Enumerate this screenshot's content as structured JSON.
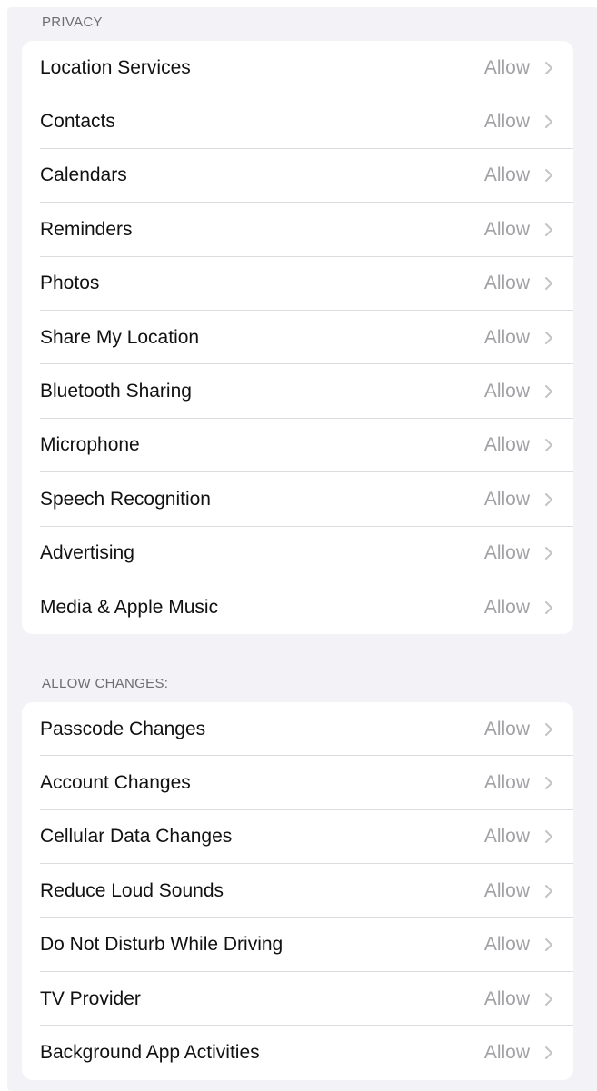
{
  "privacy": {
    "header": "PRIVACY",
    "items": [
      {
        "label": "Location Services",
        "value": "Allow"
      },
      {
        "label": "Contacts",
        "value": "Allow"
      },
      {
        "label": "Calendars",
        "value": "Allow"
      },
      {
        "label": "Reminders",
        "value": "Allow"
      },
      {
        "label": "Photos",
        "value": "Allow"
      },
      {
        "label": "Share My Location",
        "value": "Allow"
      },
      {
        "label": "Bluetooth Sharing",
        "value": "Allow"
      },
      {
        "label": "Microphone",
        "value": "Allow"
      },
      {
        "label": "Speech Recognition",
        "value": "Allow"
      },
      {
        "label": "Advertising",
        "value": "Allow"
      },
      {
        "label": "Media & Apple Music",
        "value": "Allow"
      }
    ]
  },
  "allow_changes": {
    "header": "ALLOW CHANGES:",
    "items": [
      {
        "label": "Passcode Changes",
        "value": "Allow"
      },
      {
        "label": "Account Changes",
        "value": "Allow"
      },
      {
        "label": "Cellular Data Changes",
        "value": "Allow"
      },
      {
        "label": "Reduce Loud Sounds",
        "value": "Allow"
      },
      {
        "label": "Do Not Disturb While Driving",
        "value": "Allow"
      },
      {
        "label": "TV Provider",
        "value": "Allow"
      },
      {
        "label": "Background App Activities",
        "value": "Allow"
      }
    ]
  },
  "icons": {
    "row_disclosure": "chevron-right-icon"
  },
  "colors": {
    "background": "#f2f2f7",
    "card": "#ffffff",
    "label": "#111111",
    "value": "#a1a1a6",
    "header": "#6d6d72",
    "separator": "#dcdce0"
  }
}
